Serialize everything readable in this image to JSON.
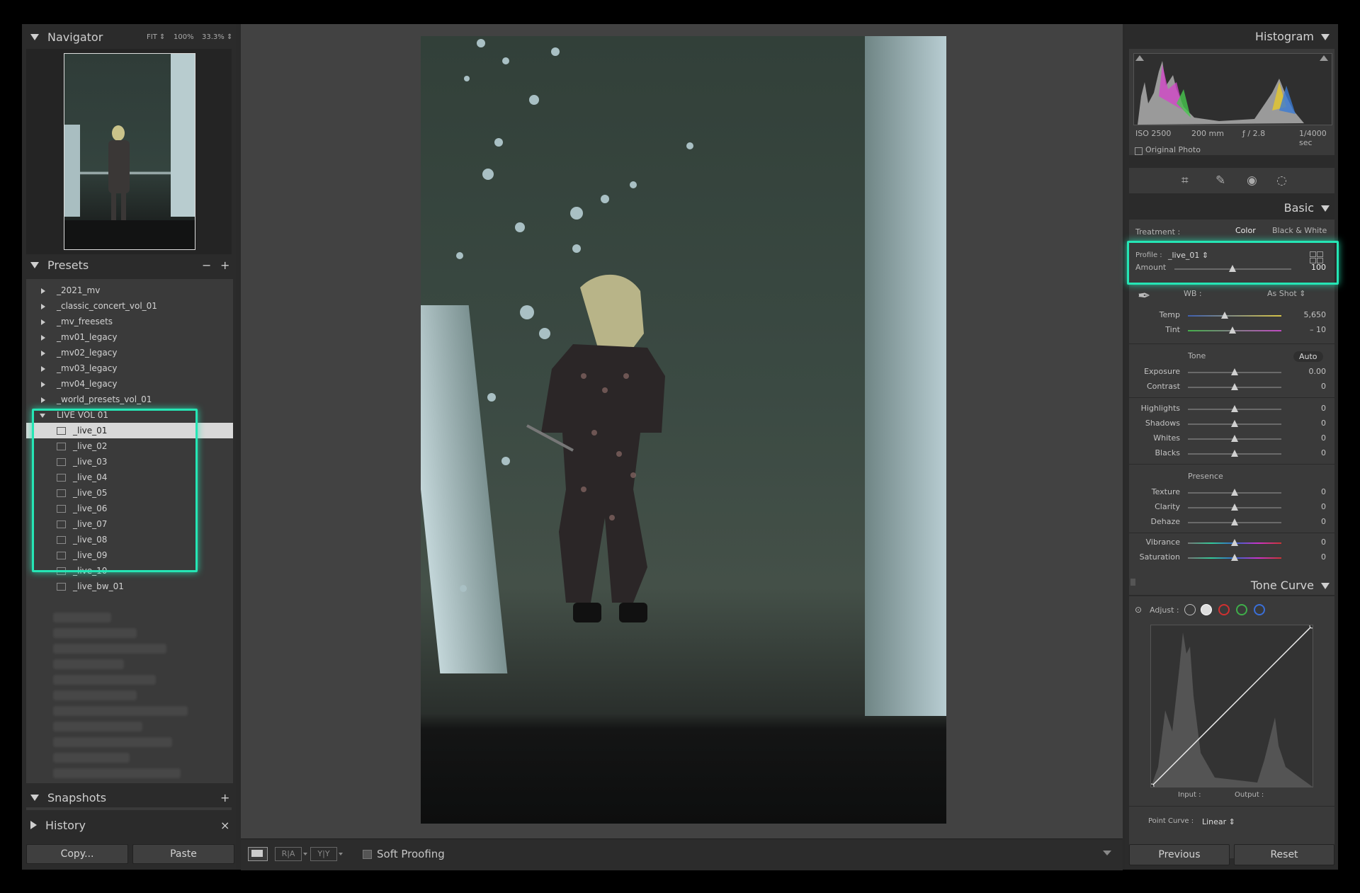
{
  "navigator": {
    "title": "Navigator",
    "zoom_fit": "FIT ⇕",
    "zoom_100": "100%",
    "zoom_33": "33.3% ⇕"
  },
  "presets": {
    "title": "Presets",
    "minus": "−",
    "plus": "+",
    "groups": [
      "_2021_mv",
      "_classic_concert_vol_01",
      "_mv_freesets",
      "_mv01_legacy",
      "_mv02_legacy",
      "_mv03_legacy",
      "_mv04_legacy",
      "_world_presets_vol_01"
    ],
    "open_group": "LIVE VOL 01",
    "items": [
      "_live_01",
      "_live_02",
      "_live_03",
      "_live_04",
      "_live_05",
      "_live_06",
      "_live_07",
      "_live_08",
      "_live_09",
      "_live_10",
      "_live_bw_01"
    ],
    "selected": "_live_01"
  },
  "snapshots": {
    "title": "Snapshots",
    "plus": "+"
  },
  "history": {
    "title": "History",
    "close": "×"
  },
  "left_buttons": {
    "copy": "Copy...",
    "paste": "Paste"
  },
  "toolbar": {
    "soft_proofing": "Soft Proofing"
  },
  "histogram": {
    "title": "Histogram",
    "iso": "ISO 2500",
    "focal": "200 mm",
    "aperture": "ƒ / 2.8",
    "shutter": "1/4000 sec",
    "original_photo": "Original Photo"
  },
  "basic": {
    "title": "Basic",
    "treatment_label": "Treatment :",
    "color": "Color",
    "bw": "Black & White",
    "profile_label": "Profile :",
    "profile_value": "_live_01 ⇕",
    "amount_label": "Amount",
    "amount_value": "100",
    "wb_label": "WB :",
    "wb_value": "As Shot ⇕",
    "temp_label": "Temp",
    "temp_value": "5,650",
    "tint_label": "Tint",
    "tint_value": "– 10",
    "tone_label": "Tone",
    "auto": "Auto",
    "exposure_label": "Exposure",
    "exposure_value": "0.00",
    "contrast_label": "Contrast",
    "contrast_value": "0",
    "highlights_label": "Highlights",
    "highlights_value": "0",
    "shadows_label": "Shadows",
    "shadows_value": "0",
    "whites_label": "Whites",
    "whites_value": "0",
    "blacks_label": "Blacks",
    "blacks_value": "0",
    "presence_label": "Presence",
    "texture_label": "Texture",
    "texture_value": "0",
    "clarity_label": "Clarity",
    "clarity_value": "0",
    "dehaze_label": "Dehaze",
    "dehaze_value": "0",
    "vibrance_label": "Vibrance",
    "vibrance_value": "0",
    "saturation_label": "Saturation",
    "saturation_value": "0"
  },
  "tone_curve": {
    "title": "Tone Curve",
    "adjust_label": "Adjust :",
    "input_label": "Input :",
    "output_label": "Output :",
    "point_curve_label": "Point Curve :",
    "point_curve_value": "Linear ⇕"
  },
  "right_buttons": {
    "previous": "Previous",
    "reset": "Reset"
  },
  "colors": {
    "highlight": "#25e6b5",
    "panel": "#2b2b2b",
    "section": "#3a3a3a",
    "canvas": "#424242"
  }
}
